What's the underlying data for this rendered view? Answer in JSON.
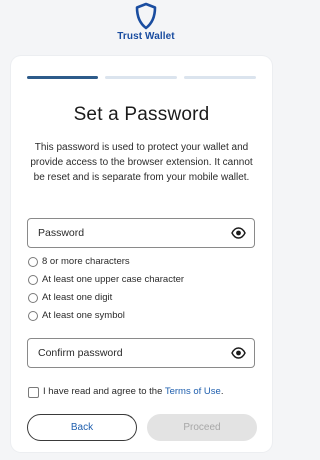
{
  "brand": {
    "name": "Trust Wallet"
  },
  "progress": {
    "steps_total": 3,
    "current_step": 1
  },
  "page": {
    "title": "Set a Password",
    "description": "This password is used to protect your wallet and provide access to the browser extension. It cannot be reset and is separate from your mobile wallet."
  },
  "password_field": {
    "placeholder": "Password"
  },
  "rules": [
    "8 or more characters",
    "At least one upper case character",
    "At least one digit",
    "At least one symbol"
  ],
  "confirm_field": {
    "placeholder": "Confirm password"
  },
  "agree": {
    "text": "I have read and agree to the ",
    "link": "Terms of Use",
    "suffix": "."
  },
  "buttons": {
    "back": "Back",
    "proceed": "Proceed"
  },
  "colors": {
    "brand_blue": "#1a4da0",
    "progress_active": "#2d5b8a",
    "link": "#1f5fae"
  },
  "icons": {
    "brand_logo": "shield-icon",
    "show_password": "eye-icon"
  }
}
